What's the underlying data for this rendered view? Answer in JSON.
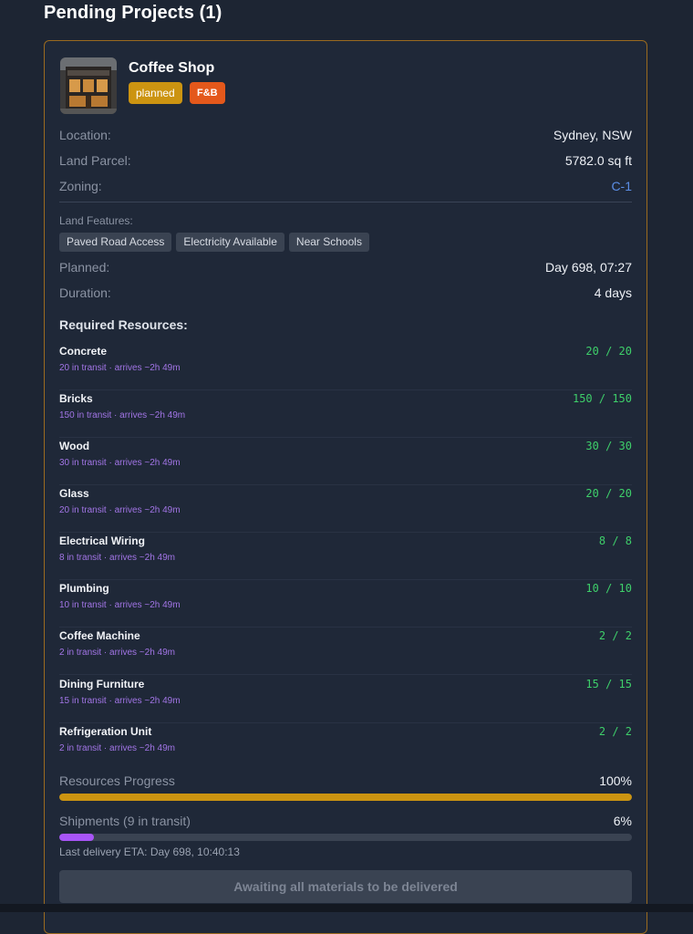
{
  "page_title": "Pending Projects (1)",
  "project": {
    "name": "Coffee Shop",
    "status": "planned",
    "type": "F&B",
    "location_label": "Location:",
    "location": "Sydney, NSW",
    "parcel_label": "Land Parcel:",
    "parcel": "5782.0 sq ft",
    "zoning_label": "Zoning:",
    "zoning": "C-1",
    "features_label": "Land Features:",
    "features": [
      "Paved Road Access",
      "Electricity Available",
      "Near Schools"
    ],
    "planned_label": "Planned:",
    "planned": "Day 698, 07:27",
    "duration_label": "Duration:",
    "duration": "4 days"
  },
  "resources_title": "Required Resources:",
  "resources": [
    {
      "name": "Concrete",
      "qty": "20 / 20",
      "transit": "20 in transit · arrives ~2h 49m"
    },
    {
      "name": "Bricks",
      "qty": "150 / 150",
      "transit": "150 in transit · arrives ~2h 49m"
    },
    {
      "name": "Wood",
      "qty": "30 / 30",
      "transit": "30 in transit · arrives ~2h 49m"
    },
    {
      "name": "Glass",
      "qty": "20 / 20",
      "transit": "20 in transit · arrives ~2h 49m"
    },
    {
      "name": "Electrical Wiring",
      "qty": "8 / 8",
      "transit": "8 in transit · arrives ~2h 49m"
    },
    {
      "name": "Plumbing",
      "qty": "10 / 10",
      "transit": "10 in transit · arrives ~2h 49m"
    },
    {
      "name": "Coffee Machine",
      "qty": "2 / 2",
      "transit": "2 in transit · arrives ~2h 49m"
    },
    {
      "name": "Dining Furniture",
      "qty": "15 / 15",
      "transit": "15 in transit · arrives ~2h 49m"
    },
    {
      "name": "Refrigeration Unit",
      "qty": "2 / 2",
      "transit": "2 in transit · arrives ~2h 49m"
    }
  ],
  "resources_progress": {
    "label": "Resources Progress",
    "value_text": "100%",
    "fraction": 1.0,
    "color": "#cc9411"
  },
  "shipments_progress": {
    "label": "Shipments (9 in transit)",
    "value_text": "6%",
    "fraction": 0.06,
    "color": "#a855f7"
  },
  "last_delivery": "Last delivery ETA: Day 698, 10:40:13",
  "action_button": "Awaiting all materials to be delivered",
  "colors": {
    "accent_border": "#9a6a1f",
    "qty_complete": "#3ecf6a",
    "transit_text": "#a275e6",
    "zoning_link": "#5b8ee6"
  }
}
